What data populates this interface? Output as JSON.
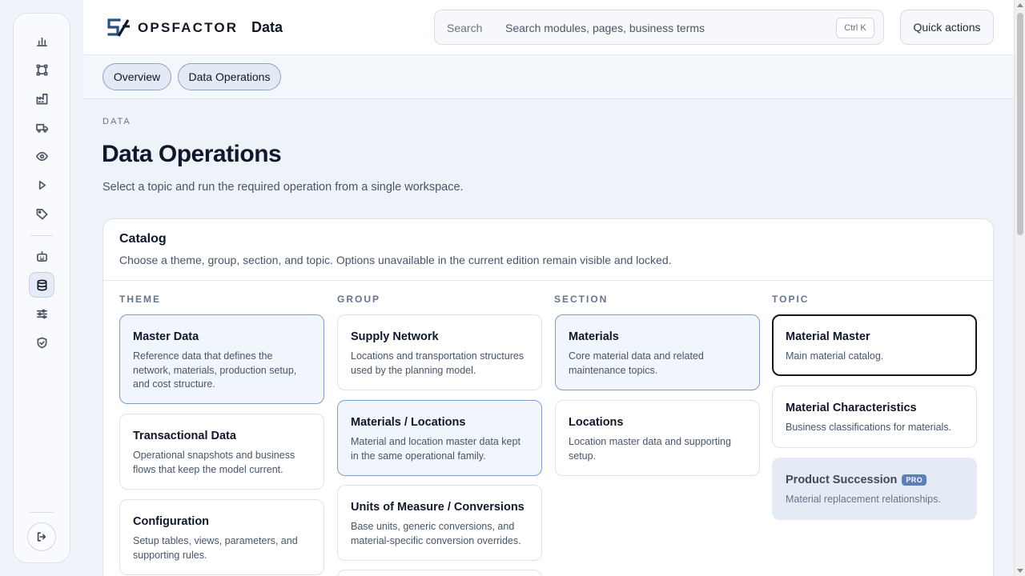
{
  "brand": {
    "name": "OPSFACTOR"
  },
  "header": {
    "module_title": "Data",
    "search_label": "Search",
    "search_placeholder": "Search modules, pages, business terms",
    "search_shortcut": "Ctrl K",
    "quick_actions_label": "Quick actions"
  },
  "rail": {
    "icons": [
      "chart-icon",
      "network-icon",
      "factory-icon",
      "truck-icon",
      "eye-icon",
      "play-icon",
      "tag-icon",
      "robot-icon",
      "database-icon",
      "sliders-icon",
      "shield-icon"
    ],
    "active": "database-icon",
    "logout_icon": "logout-icon"
  },
  "tabs": [
    {
      "label": "Overview"
    },
    {
      "label": "Data Operations"
    }
  ],
  "page": {
    "eyebrow": "DATA",
    "title": "Data Operations",
    "subtitle": "Select a topic and run the required operation from a single workspace."
  },
  "catalog": {
    "title": "Catalog",
    "description": "Choose a theme, group, section, and topic. Options unavailable in the current edition remain visible and locked.",
    "columns": {
      "theme": {
        "label": "THEME",
        "items": [
          {
            "title": "Master Data",
            "description": "Reference data that defines the network, materials, production setup, and cost structure.",
            "state": "selected"
          },
          {
            "title": "Transactional Data",
            "description": "Operational snapshots and business flows that keep the model current.",
            "state": "default"
          },
          {
            "title": "Configuration",
            "description": "Setup tables, views, parameters, and supporting rules.",
            "state": "default"
          }
        ]
      },
      "group": {
        "label": "GROUP",
        "items": [
          {
            "title": "Supply Network",
            "description": "Locations and transportation structures used by the planning model.",
            "state": "default"
          },
          {
            "title": "Materials / Locations",
            "description": "Material and location master data kept in the same operational family.",
            "state": "selected"
          },
          {
            "title": "Units of Measure / Conversions",
            "description": "Base units, generic conversions, and material-specific conversion overrides.",
            "state": "default"
          }
        ]
      },
      "section": {
        "label": "SECTION",
        "items": [
          {
            "title": "Materials",
            "description": "Core material data and related maintenance topics.",
            "state": "selected"
          },
          {
            "title": "Locations",
            "description": "Location master data and supporting setup.",
            "state": "default"
          }
        ]
      },
      "topic": {
        "label": "TOPIC",
        "items": [
          {
            "title": "Material Master",
            "description": "Main material catalog.",
            "state": "focused"
          },
          {
            "title": "Material Characteristics",
            "description": "Business classifications for materials.",
            "state": "default"
          },
          {
            "title": "Product Succession",
            "description": "Material replacement relationships.",
            "state": "locked",
            "badge": "PRO"
          }
        ]
      }
    }
  },
  "colors": {
    "accent_border": "#7f9ccb",
    "selected_bg": "#f1f5fc",
    "locked_bg": "#e5ebf5",
    "pro_badge": "#5b7fb6"
  }
}
